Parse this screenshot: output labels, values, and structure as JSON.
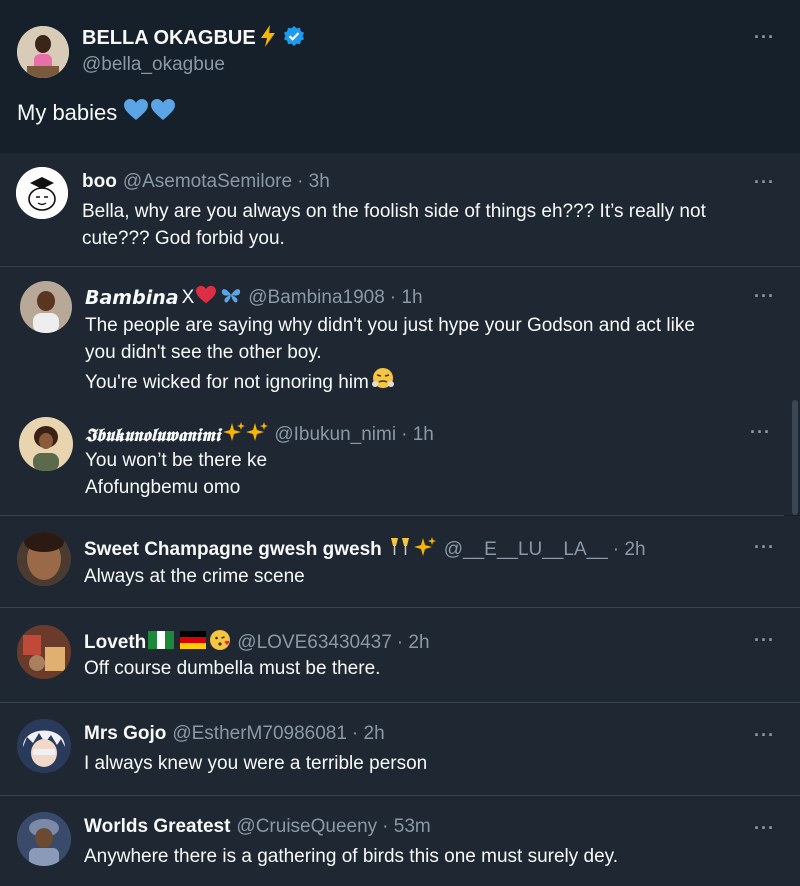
{
  "main": {
    "name": "BELLA OKAGBUE",
    "handle": "@bella_okagbue",
    "text": "My babies"
  },
  "more_label": "···",
  "replies": [
    {
      "name": "boo",
      "handle": "@AsemotaSemilore",
      "time": "· 3h",
      "lines": [
        "Bella, why are you always on the foolish side of things eh??? It’s really not",
        "cute??? God forbid you."
      ]
    },
    {
      "name": "𝘽𝙖𝙢𝙗𝙞𝙣𝙖",
      "name_suffix": "X",
      "handle": "@Bambina1908",
      "time": "· 1h",
      "lines": [
        "The people are saying why didn't you just hype your Godson and act like",
        "you didn't see the other boy.",
        "You're wicked for not ignoring him"
      ]
    },
    {
      "name": "𝕴𝖇𝖚𝖐𝖚𝖓𝖔𝖑𝖚𝖜𝖆𝖓𝖎𝖒𝖎",
      "handle": "@Ibukun_nimi",
      "time": "· 1h",
      "lines": [
        "You won’t be there ke",
        "Afofungbemu omo"
      ]
    },
    {
      "name": "Sweet Champagne gwesh gwesh",
      "handle": "@__E__LU__LA__",
      "time": "· 2h",
      "lines": [
        "Always at the crime scene"
      ]
    },
    {
      "name": "Loveth",
      "handle": "@LOVE63430437",
      "time": "· 2h",
      "lines": [
        "Off course dumbella must be there."
      ]
    },
    {
      "name": "Mrs Gojo",
      "handle": "@EstherM70986081",
      "time": "· 2h",
      "lines": [
        "I always knew you were a terrible person"
      ]
    },
    {
      "name": "Worlds Greatest",
      "handle": "@CruiseQueeny",
      "time": "· 53m",
      "lines": [
        "Anywhere there is a gathering of birds this one must surely dey."
      ]
    }
  ],
  "colors": {
    "background": "#15202b",
    "reply_background": "#1e2732",
    "secondary_text": "#8b98a5",
    "verified_blue": "#1d9bf0",
    "heart_blue": "#5ba4e6"
  },
  "icons": [
    "lightning-icon",
    "verified-badge-icon",
    "blue-heart-icon",
    "more-icon",
    "red-heart-icon",
    "butterfly-icon",
    "sparkles-icon",
    "champagne-icon",
    "nigeria-flag-icon",
    "germany-flag-icon",
    "kiss-face-icon",
    "huffing-face-icon"
  ]
}
